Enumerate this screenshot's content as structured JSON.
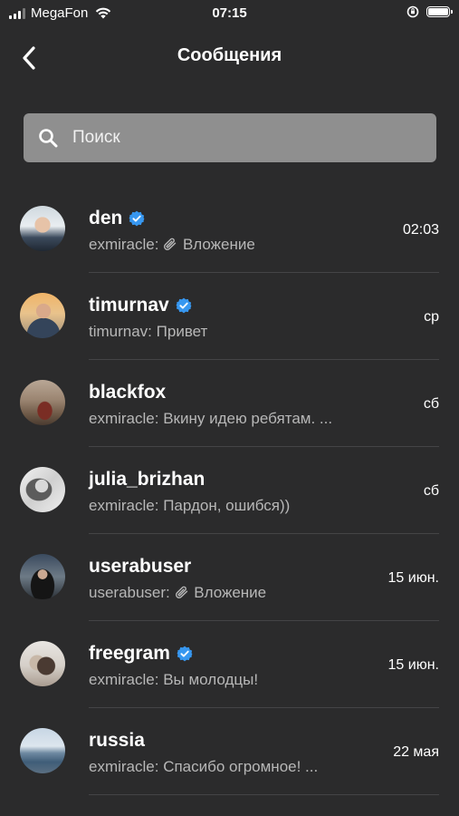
{
  "status_bar": {
    "carrier": "MegaFon",
    "time": "07:15"
  },
  "nav": {
    "title": "Сообщения",
    "back_icon": "chevron-left-icon"
  },
  "search": {
    "placeholder": "Поиск",
    "value": "",
    "icon": "search-icon"
  },
  "colors": {
    "background": "#2b2b2c",
    "search_background": "#8f8f8f",
    "verified_badge": "#3797f0",
    "secondary_text": "#b7b7b7",
    "divider": "#444446"
  },
  "chats": [
    {
      "name": "den",
      "verified": true,
      "sender": "exmiracle:",
      "attachment": true,
      "message": "Вложение",
      "time": "02:03"
    },
    {
      "name": "timurnav",
      "verified": true,
      "sender": "timurnav:",
      "attachment": false,
      "message": "Привет",
      "time": "ср"
    },
    {
      "name": "blackfox",
      "verified": false,
      "sender": "exmiracle:",
      "attachment": false,
      "message": "Вкину идею ребятам. ...",
      "time": "сб"
    },
    {
      "name": "julia_brizhan",
      "verified": false,
      "sender": "exmiracle:",
      "attachment": false,
      "message": "Пардон, ошибся))",
      "time": "сб"
    },
    {
      "name": "userabuser",
      "verified": false,
      "sender": "userabuser:",
      "attachment": true,
      "message": "Вложение",
      "time": "15 июн."
    },
    {
      "name": "freegram",
      "verified": true,
      "sender": "exmiracle:",
      "attachment": false,
      "message": "Вы молодцы!",
      "time": "15 июн."
    },
    {
      "name": "russia",
      "verified": false,
      "sender": "exmiracle:",
      "attachment": false,
      "message": "Спасибо огромное! ...",
      "time": "22 мая"
    }
  ]
}
